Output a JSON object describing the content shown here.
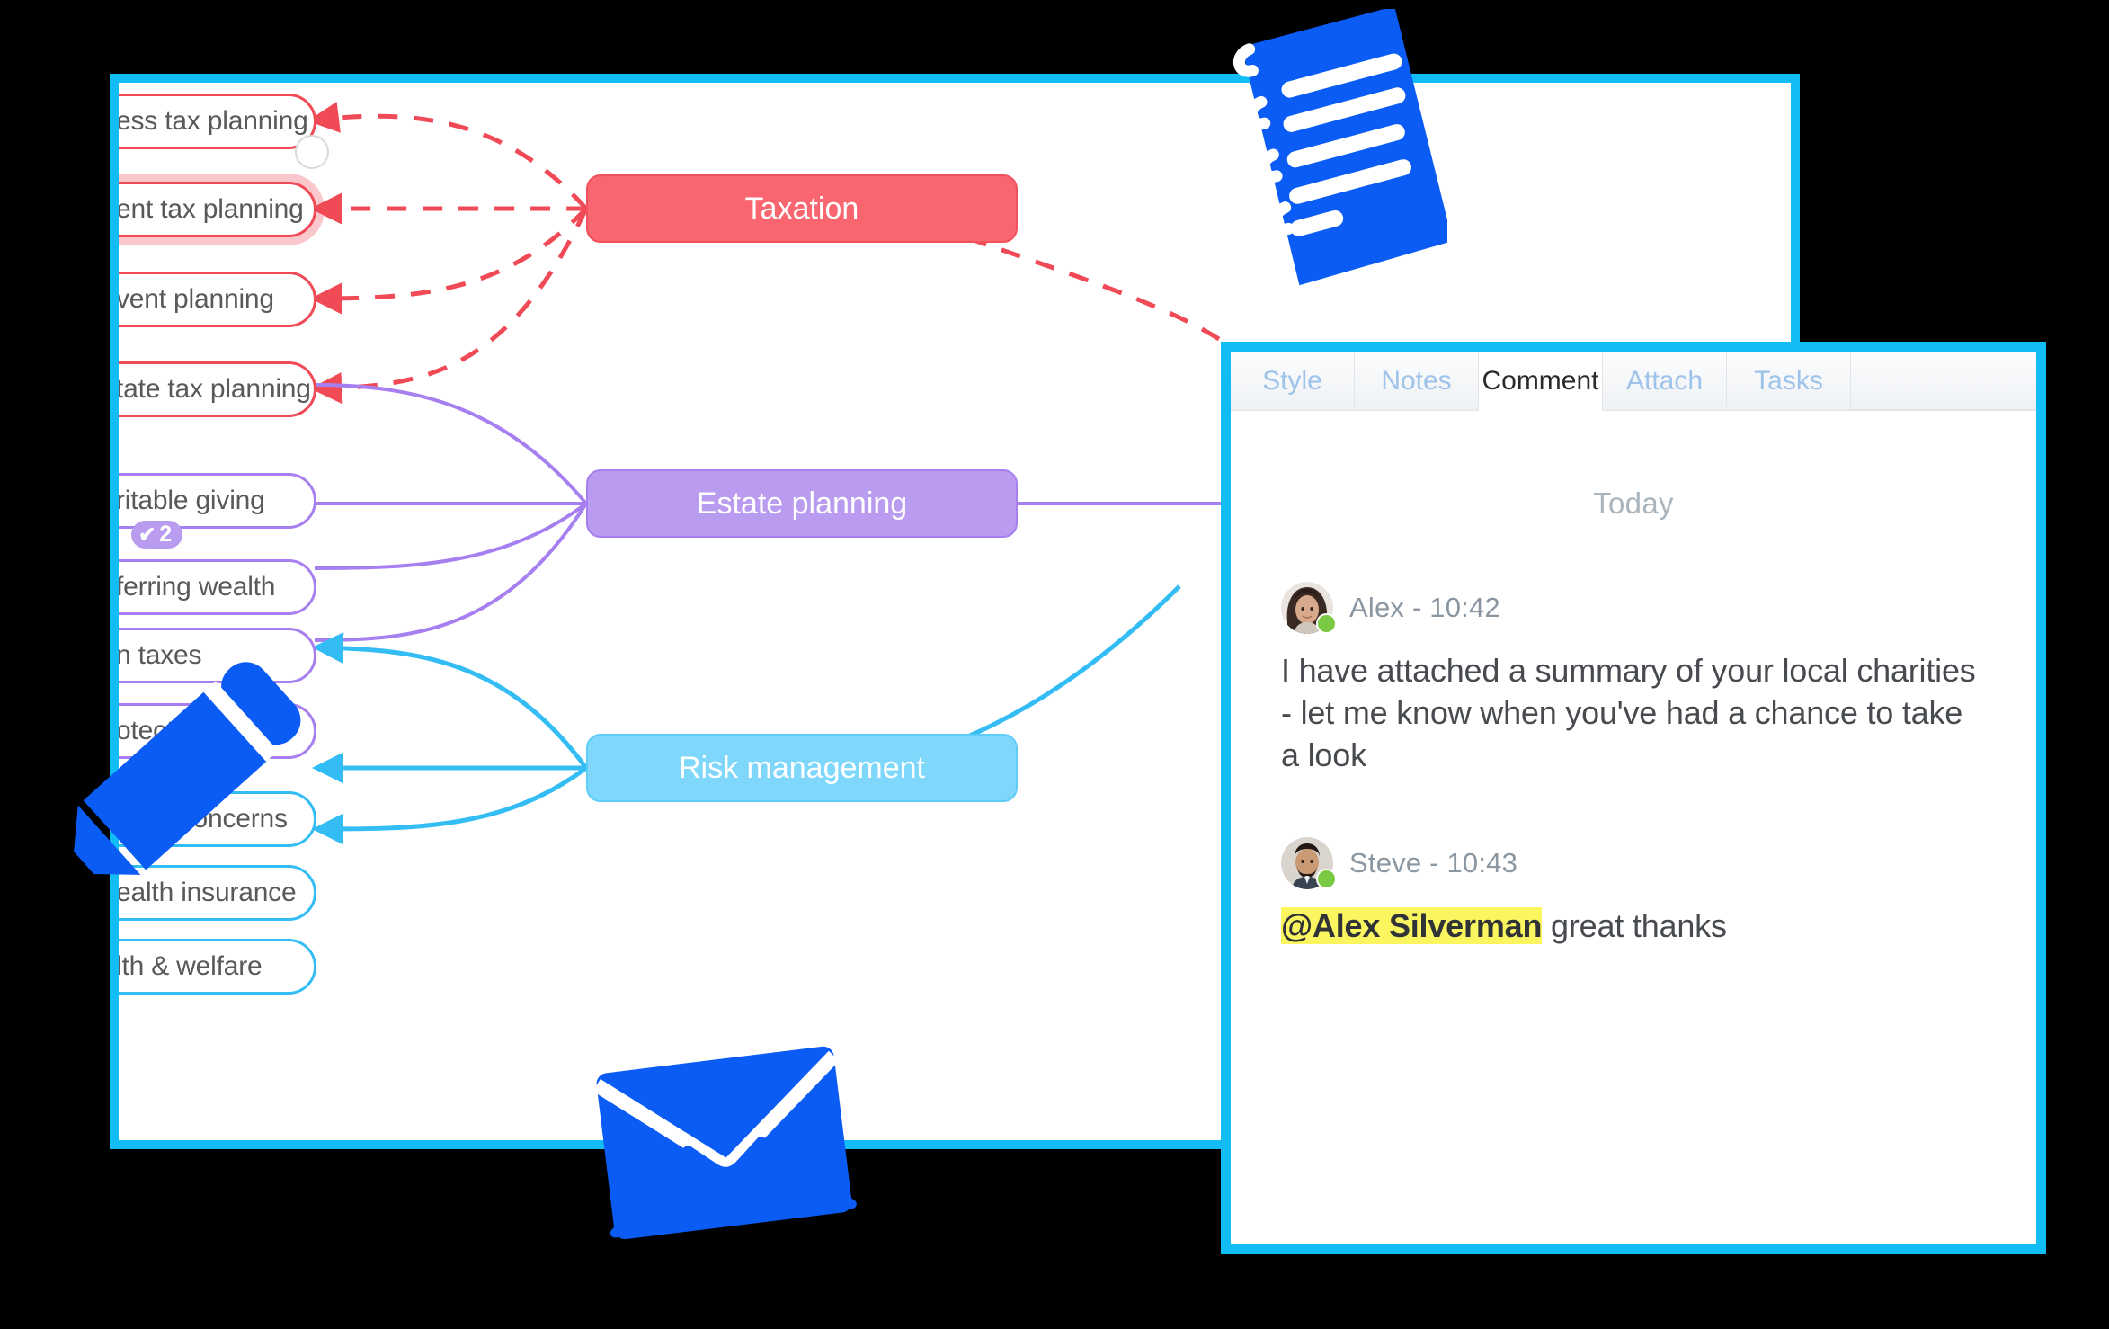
{
  "mindmap": {
    "window_name": "mind-map-canvas",
    "branches": [
      {
        "name": "taxation",
        "color": "#f9666f",
        "central_label": "Taxation",
        "leaves": [
          {
            "label": "ess tax planning",
            "full": "Business tax planning",
            "selected": false
          },
          {
            "label": "ent tax planning",
            "full": "Investment tax planning",
            "selected": true
          },
          {
            "label": "vent planning",
            "full": "Event planning",
            "selected": false
          },
          {
            "label": "tate tax planning",
            "full": "Estate tax planning",
            "selected": false
          }
        ]
      },
      {
        "name": "estate-planning",
        "color": "#b99bf0",
        "central_label": "Estate planning",
        "leaves": [
          {
            "label": "ritable giving",
            "full": "Charitable giving",
            "selected": false,
            "badge": "2"
          },
          {
            "label": "ferring wealth",
            "full": "Transferring wealth",
            "selected": false
          },
          {
            "label": "n  taxes",
            "full": "Inheritance taxes",
            "selected": false
          },
          {
            "label": "otection",
            "full": "Asset protection",
            "selected": false
          }
        ]
      },
      {
        "name": "risk-management",
        "color": "#7fd8fb",
        "central_label": "Risk management",
        "leaves": [
          {
            "label": "ness concerns",
            "full": "Business concerns",
            "selected": false
          },
          {
            "label": "ealth insurance",
            "full": "Health insurance",
            "selected": false
          },
          {
            "label": "lth & welfare",
            "full": "Health & welfare",
            "selected": false
          }
        ]
      }
    ]
  },
  "comment_panel": {
    "tabs": [
      {
        "label": "Style",
        "active": false
      },
      {
        "label": "Notes",
        "active": false
      },
      {
        "label": "Comment",
        "active": true
      },
      {
        "label": "Attach",
        "active": false
      },
      {
        "label": "Tasks",
        "active": false
      }
    ],
    "date_separator": "Today",
    "comments": [
      {
        "author": "Alex",
        "separator": "-",
        "time": "10:42",
        "status": "online",
        "text": "I have attached a summary of your local charities - let me know when you've had a chance to take a look",
        "mention": null
      },
      {
        "author": "Steve",
        "separator": "-",
        "time": "10:43",
        "status": "online",
        "mention": "@Alex Silverman",
        "text": " great thanks"
      }
    ]
  },
  "floating_icons": [
    {
      "name": "document-icon",
      "color": "#0a5cf5"
    },
    {
      "name": "pencil-icon",
      "color": "#0a5cf5"
    },
    {
      "name": "envelope-icon",
      "color": "#0a5cf5"
    }
  ],
  "colors": {
    "accent_border": "#12bdf5",
    "red": "#f04a56",
    "purple": "#a67ff0",
    "cyan": "#34bdf5",
    "highlight": "#fbf55f",
    "online": "#7ac943"
  }
}
